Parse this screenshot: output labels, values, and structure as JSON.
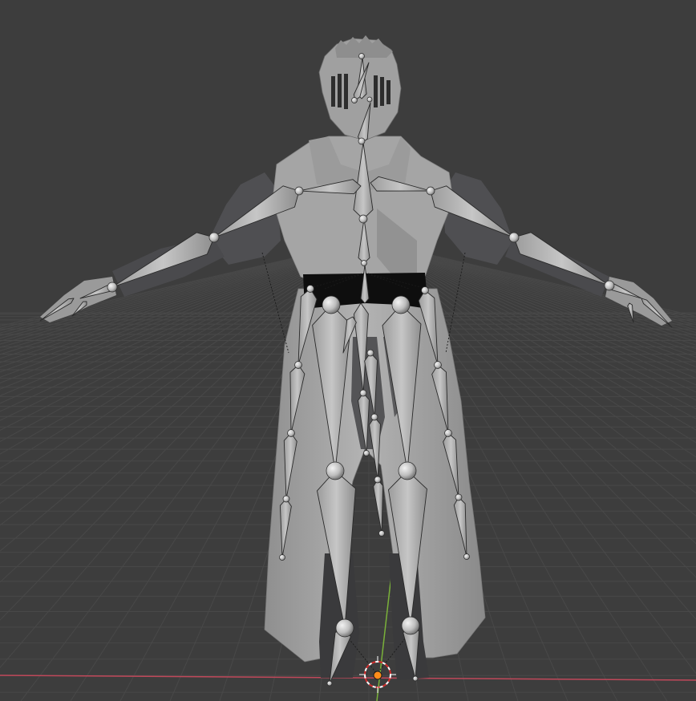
{
  "viewport": {
    "background": "#3d3d3d",
    "grid_color": "#4a4a4a",
    "x_axis_color": "#c0485a",
    "y_axis_color": "#7ab13a",
    "origin_color": "#ff8c1a",
    "cursor_colors": [
      "#ffffff",
      "#d22d2d"
    ]
  },
  "model": {
    "mesh_color": "#a8a8a8",
    "armor_dark": "#4f4f52",
    "belt_color": "#0e0e0e",
    "bone_color": "#b5b5b5",
    "bone_stroke": "#2a2a2a"
  },
  "scene_objects": [
    "knight-mesh",
    "armature",
    "3d-cursor",
    "origin"
  ]
}
